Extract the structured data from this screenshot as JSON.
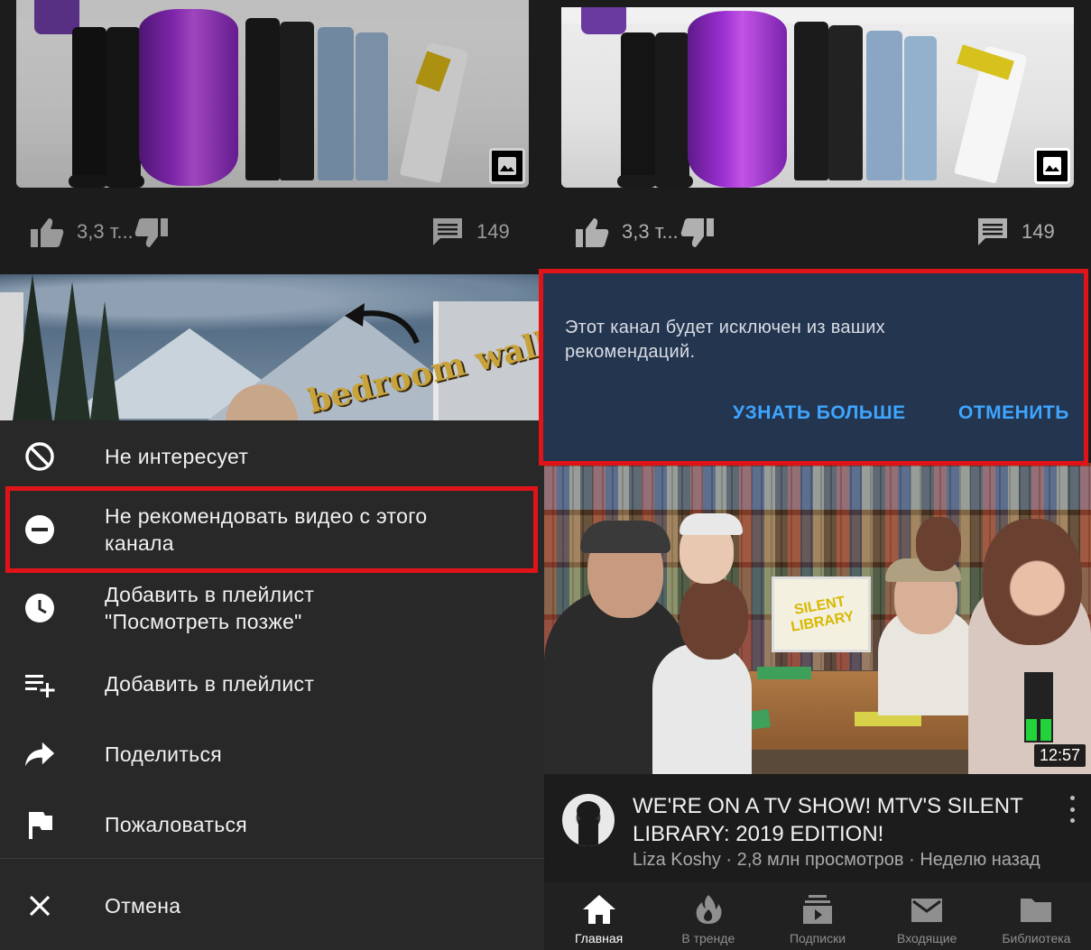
{
  "left": {
    "likes": "3,3 т...",
    "comments": "149",
    "wall_text": "bedroom wall",
    "menu": [
      {
        "id": "not-interested",
        "label": "Не интересует",
        "icon": "block-icon"
      },
      {
        "id": "dont-recommend",
        "label": "Не рекомендовать видео с этого канала",
        "icon": "minus-circle-icon"
      },
      {
        "id": "watch-later",
        "label": "Добавить в плейлист \"Посмотреть позже\"",
        "icon": "clock-icon"
      },
      {
        "id": "add-playlist",
        "label": "Добавить в плейлист",
        "icon": "playlist-add-icon"
      },
      {
        "id": "share",
        "label": "Поделиться",
        "icon": "share-icon"
      },
      {
        "id": "report",
        "label": "Пожаловаться",
        "icon": "flag-icon"
      },
      {
        "id": "cancel",
        "label": "Отмена",
        "icon": "close-icon"
      }
    ],
    "highlight_color": "#e01418"
  },
  "right": {
    "likes": "3,3 т...",
    "comments": "149",
    "snackbar": {
      "message": "Этот канал будет исключен из ваших рекомендаций.",
      "learn_more": "УЗНАТЬ БОЛЬШЕ",
      "undo": "ОТМЕНИТЬ"
    },
    "thumb_sign": "SILENT LIBRARY",
    "video": {
      "duration": "12:57",
      "title": "WE'RE ON A TV SHOW! MTV'S SILENT LIBRARY: 2019 EDITION!",
      "channel": "Liza Koshy",
      "views": "2,8 млн просмотров",
      "age": "Неделю назад",
      "separator": " · "
    },
    "nav": [
      {
        "id": "home",
        "label": "Главная",
        "icon": "home-icon",
        "active": true
      },
      {
        "id": "trending",
        "label": "В тренде",
        "icon": "fire-icon",
        "active": false
      },
      {
        "id": "subscriptions",
        "label": "Подписки",
        "icon": "subscriptions-icon",
        "active": false
      },
      {
        "id": "inbox",
        "label": "Входящие",
        "icon": "mail-icon",
        "active": false
      },
      {
        "id": "library",
        "label": "Библиотека",
        "icon": "folder-icon",
        "active": false
      }
    ],
    "accent": "#3ea6ff",
    "snackbar_bg": "#243550"
  }
}
